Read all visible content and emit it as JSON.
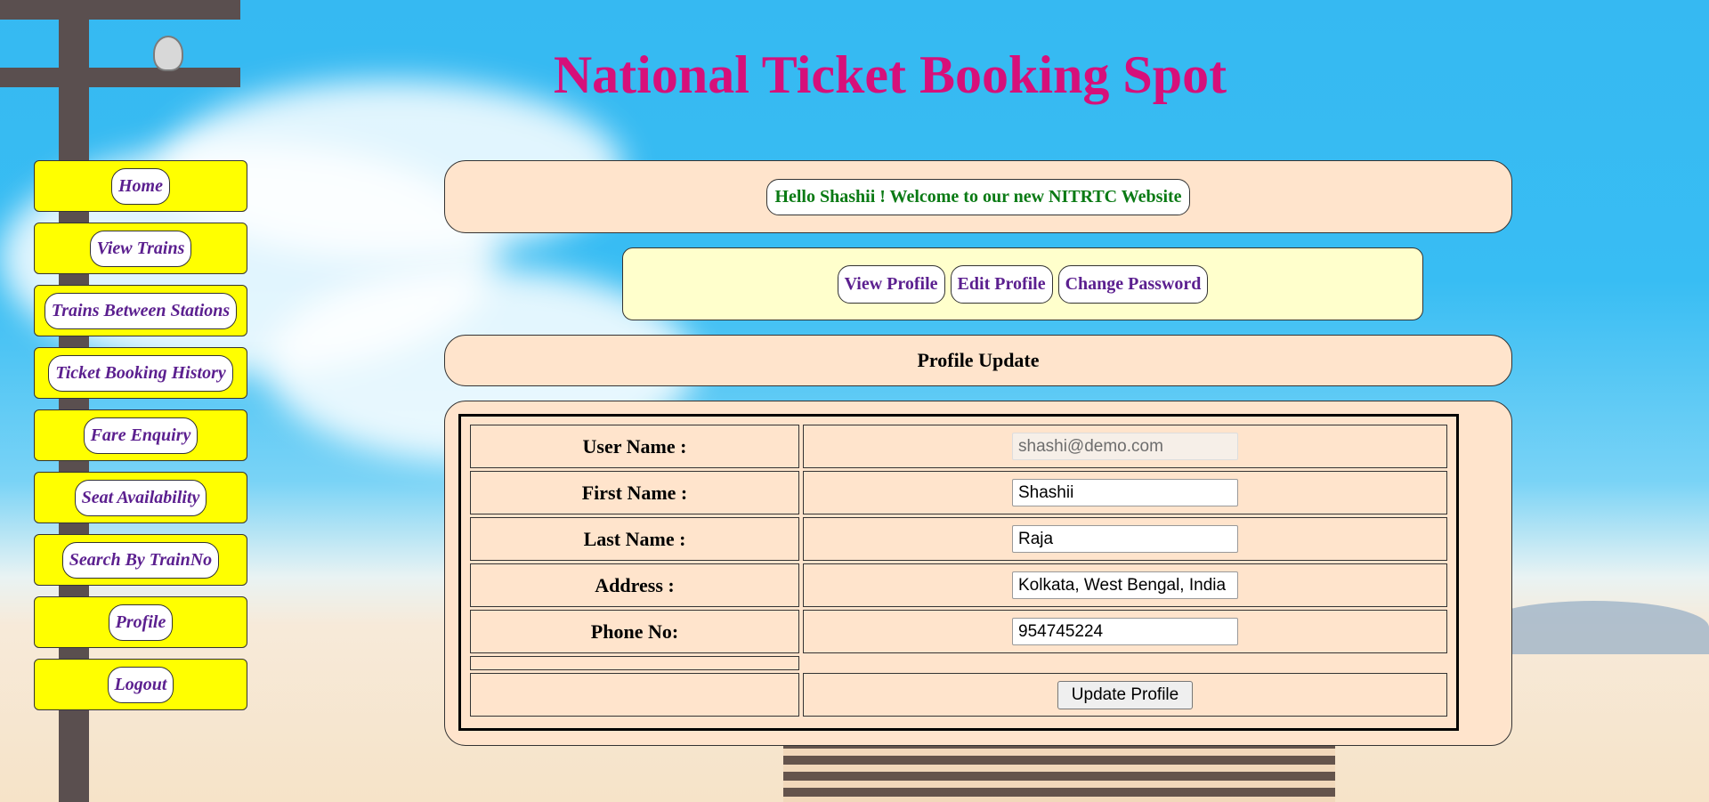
{
  "site_title": "National Ticket Booking Spot",
  "nav": [
    {
      "label": "Home"
    },
    {
      "label": "View Trains"
    },
    {
      "label": "Trains Between Stations"
    },
    {
      "label": "Ticket Booking History"
    },
    {
      "label": "Fare Enquiry"
    },
    {
      "label": "Seat Availability"
    },
    {
      "label": "Search By TrainNo"
    },
    {
      "label": "Profile"
    },
    {
      "label": "Logout"
    }
  ],
  "welcome": "Hello Shashii ! Welcome to our new NITRTC Website",
  "profile_actions": {
    "view": "View Profile",
    "edit": "Edit Profile",
    "password": "Change Password"
  },
  "section_heading": "Profile Update",
  "form": {
    "user_name": {
      "label": "User Name :",
      "value": "shashi@demo.com"
    },
    "first_name": {
      "label": "First Name :",
      "value": "Shashii"
    },
    "last_name": {
      "label": "Last Name :",
      "value": "Raja"
    },
    "address": {
      "label": "Address :",
      "value": "Kolkata, West Bengal, India"
    },
    "phone": {
      "label": "Phone No:",
      "value": "954745224"
    },
    "submit_label": "Update Profile"
  }
}
